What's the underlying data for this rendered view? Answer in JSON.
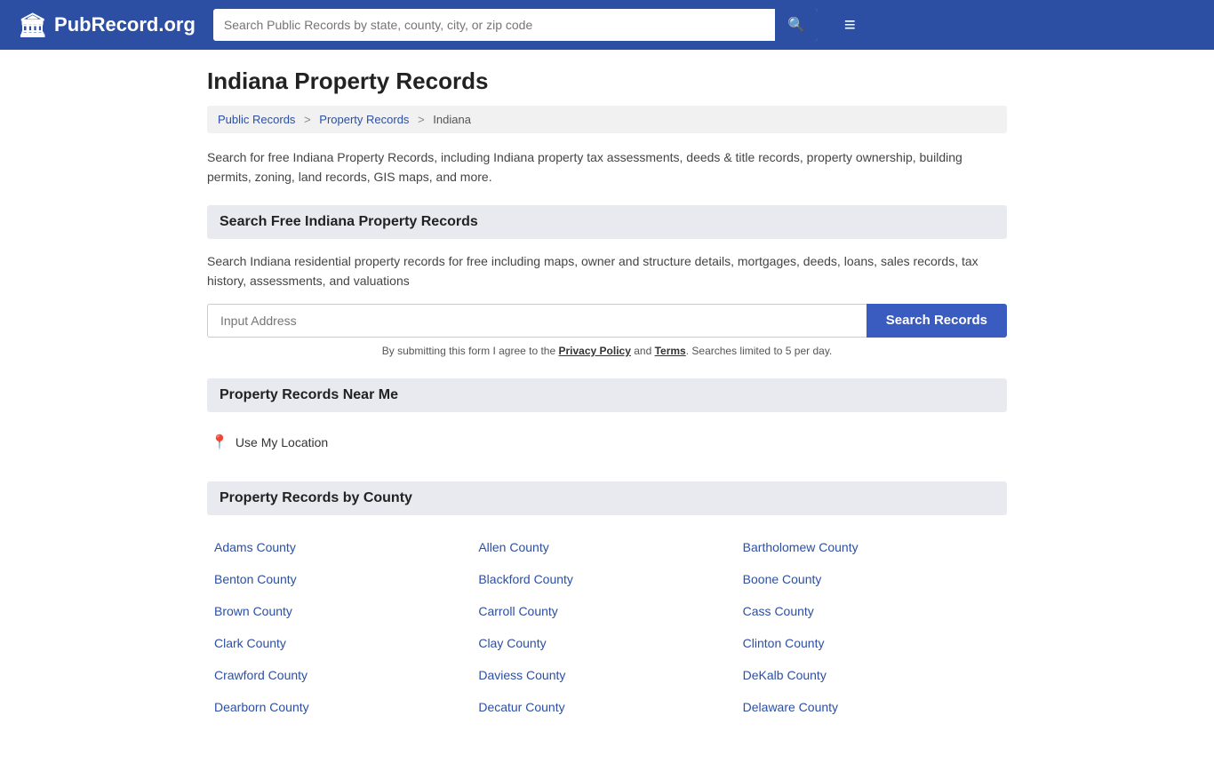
{
  "header": {
    "logo_text": "PubRecord.org",
    "search_placeholder": "Search Public Records by state, county, city, or zip code",
    "search_button_icon": "🔍",
    "hamburger_icon": "≡"
  },
  "page": {
    "title": "Indiana Property Records",
    "breadcrumb": {
      "items": [
        "Public Records",
        "Property Records",
        "Indiana"
      ],
      "separators": [
        ">",
        ">"
      ]
    },
    "description": "Search for free Indiana Property Records, including Indiana property tax assessments, deeds & title records, property ownership, building permits, zoning, land records, GIS maps, and more.",
    "search_section": {
      "heading": "Search Free Indiana Property Records",
      "description": "Search Indiana residential property records for free including maps, owner and structure details, mortgages, deeds, loans, sales records, tax history, assessments, and valuations",
      "input_placeholder": "Input Address",
      "button_label": "Search Records",
      "disclaimer_text": "By submitting this form I agree to the ",
      "privacy_policy_label": "Privacy Policy",
      "and_text": " and ",
      "terms_label": "Terms",
      "limit_text": ". Searches limited to 5 per day."
    },
    "near_me_section": {
      "heading": "Property Records Near Me",
      "use_location_label": "Use My Location"
    },
    "county_section": {
      "heading": "Property Records by County",
      "counties": [
        "Adams County",
        "Allen County",
        "Bartholomew County",
        "Benton County",
        "Blackford County",
        "Boone County",
        "Brown County",
        "Carroll County",
        "Cass County",
        "Clark County",
        "Clay County",
        "Clinton County",
        "Crawford County",
        "Daviess County",
        "DeKalb County",
        "Dearborn County",
        "Decatur County",
        "Delaware County"
      ]
    }
  }
}
